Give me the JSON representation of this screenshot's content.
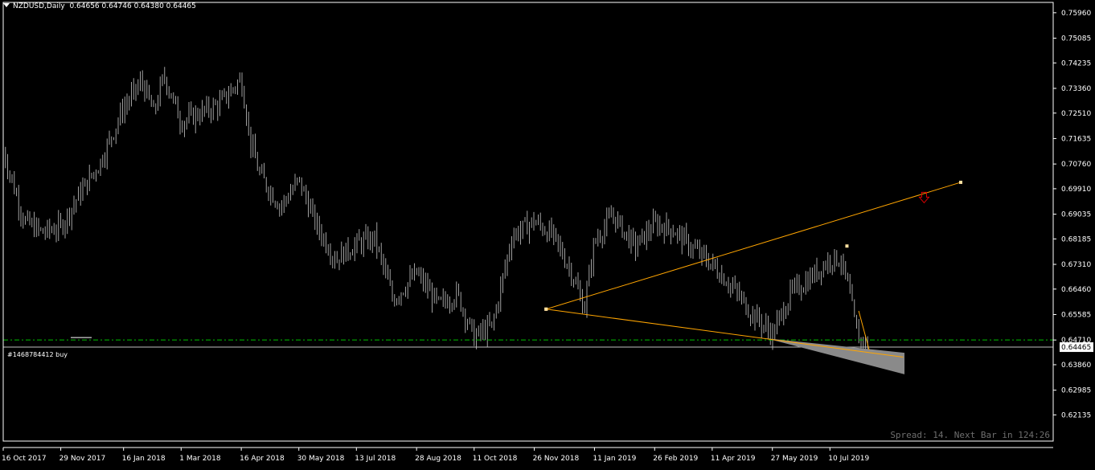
{
  "header": {
    "symbol": "NZDUSD,Daily",
    "ohlc": "0.64656 0.64746 0.64380 0.64465"
  },
  "order": {
    "label": "#1468784412 buy"
  },
  "status": {
    "spread_text": "Spread: 14. Next Bar in 124:26"
  },
  "colors": {
    "background": "#000000",
    "candles": "#a0a0a0",
    "trendline": "#ffa500",
    "order_line": "#00c000",
    "bid_line": "#c0c0c0",
    "sell_arrow": "#e00000",
    "axis_text": "#ffffff"
  },
  "chart_data": {
    "type": "candlestick",
    "symbol": "NZDUSD",
    "timeframe": "Daily",
    "ylim": [
      0.61235,
      0.76315
    ],
    "y_ticks": [
      "0.75960",
      "0.75085",
      "0.74235",
      "0.73360",
      "0.72510",
      "0.71635",
      "0.70760",
      "0.69910",
      "0.69035",
      "0.68185",
      "0.67310",
      "0.66460",
      "0.65585",
      "0.64710",
      "0.63860",
      "0.62985",
      "0.62135"
    ],
    "x_ticks": [
      "16 Oct 2017",
      "29 Nov 2017",
      "16 Jan 2018",
      "1 Mar 2018",
      "16 Apr 2018",
      "30 May 2018",
      "13 Jul 2018",
      "28 Aug 2018",
      "11 Oct 2018",
      "26 Nov 2018",
      "11 Jan 2019",
      "26 Feb 2019",
      "11 Apr 2019",
      "27 May 2019",
      "10 Jul 2019"
    ],
    "current_price": "0.64465",
    "order_price": 0.6471,
    "close_path": [
      [
        "16 Oct 2017",
        0.712
      ],
      [
        "01 Nov 2017",
        0.688
      ],
      [
        "15 Nov 2017",
        0.684
      ],
      [
        "29 Nov 2017",
        0.686
      ],
      [
        "13 Dec 2017",
        0.697
      ],
      [
        "29 Dec 2017",
        0.708
      ],
      [
        "16 Jan 2018",
        0.727
      ],
      [
        "30 Jan 2018",
        0.736
      ],
      [
        "08 Feb 2018",
        0.725
      ],
      [
        "16 Feb 2018",
        0.738
      ],
      [
        "01 Mar 2018",
        0.722
      ],
      [
        "15 Mar 2018",
        0.725
      ],
      [
        "30 Mar 2018",
        0.728
      ],
      [
        "16 Apr 2018",
        0.737
      ],
      [
        "23 Apr 2018",
        0.715
      ],
      [
        "30 Apr 2018",
        0.704
      ],
      [
        "16 May 2018",
        0.693
      ],
      [
        "30 May 2018",
        0.702
      ],
      [
        "13 Jun 2018",
        0.686
      ],
      [
        "27 Jun 2018",
        0.675
      ],
      [
        "13 Jul 2018",
        0.68
      ],
      [
        "27 Jul 2018",
        0.682
      ],
      [
        "10 Aug 2018",
        0.661
      ],
      [
        "28 Aug 2018",
        0.67
      ],
      [
        "14 Sep 2018",
        0.659
      ],
      [
        "28 Sep 2018",
        0.663
      ],
      [
        "11 Oct 2018",
        0.648
      ],
      [
        "25 Oct 2018",
        0.652
      ],
      [
        "09 Nov 2018",
        0.683
      ],
      [
        "26 Nov 2018",
        0.688
      ],
      [
        "10 Dec 2018",
        0.683
      ],
      [
        "24 Dec 2018",
        0.671
      ],
      [
        "03 Jan 2019",
        0.658
      ],
      [
        "11 Jan 2019",
        0.681
      ],
      [
        "25 Jan 2019",
        0.69
      ],
      [
        "11 Feb 2019",
        0.679
      ],
      [
        "26 Feb 2019",
        0.687
      ],
      [
        "12 Mar 2019",
        0.685
      ],
      [
        "26 Mar 2019",
        0.679
      ],
      [
        "11 Apr 2019",
        0.673
      ],
      [
        "25 Apr 2019",
        0.666
      ],
      [
        "10 May 2019",
        0.657
      ],
      [
        "27 May 2019",
        0.649
      ],
      [
        "10 Jun 2019",
        0.663
      ],
      [
        "24 Jun 2019",
        0.668
      ],
      [
        "10 Jul 2019",
        0.675
      ],
      [
        "18 Jul 2019",
        0.675
      ],
      [
        "24 Jul 2019",
        0.665
      ],
      [
        "31 Jul 2019",
        0.648
      ],
      [
        "06 Aug 2019",
        0.646
      ],
      [
        "09 Aug 2019",
        0.64465
      ]
    ],
    "trendlines": [
      {
        "name": "upper",
        "from": [
          "05 Dec 2018",
          0.6577
        ],
        "to": [
          "23 Jul 2019",
          0.6794
        ],
        "extend_to": [
          "18 Oct 2019",
          0.7013
        ]
      },
      {
        "name": "lower",
        "from": [
          "05 Dec 2018",
          0.6577
        ],
        "to": [
          "04 Sep 2019",
          0.6412
        ]
      }
    ],
    "sell_arrow": [
      "20 Sep 2019",
      0.6962
    ]
  }
}
